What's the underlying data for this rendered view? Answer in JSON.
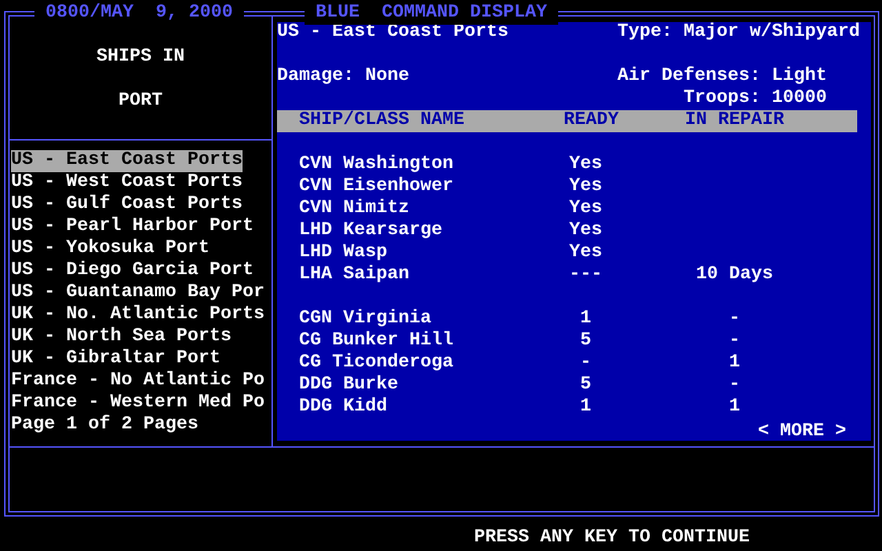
{
  "window": {
    "datetime": "0800/MAY  9, 2000",
    "title": "BLUE  COMMAND DISPLAY"
  },
  "sidebar": {
    "heading": [
      "SHIPS IN",
      "PORT"
    ],
    "items": [
      {
        "label": "US - East Coast Ports",
        "selected": true
      },
      {
        "label": "US - West Coast Ports",
        "selected": false
      },
      {
        "label": "US - Gulf Coast Ports",
        "selected": false
      },
      {
        "label": "US - Pearl Harbor Port",
        "selected": false
      },
      {
        "label": "US - Yokosuka Port",
        "selected": false
      },
      {
        "label": "US - Diego Garcia Port",
        "selected": false
      },
      {
        "label": "US - Guantanamo Bay Por",
        "selected": false
      },
      {
        "label": "UK - No. Atlantic Ports",
        "selected": false
      },
      {
        "label": "UK - North Sea Ports",
        "selected": false
      },
      {
        "label": "UK - Gibraltar Port",
        "selected": false
      },
      {
        "label": "France - No Atlantic Po",
        "selected": false
      },
      {
        "label": "France - Western Med Po",
        "selected": false
      }
    ],
    "page": "Page 1 of 2 Pages"
  },
  "port": {
    "name": "US - East Coast Ports",
    "type": "Type: Major w/Shipyard",
    "damage": "Damage: None",
    "air_defenses": "Air Defenses: Light",
    "troops": "Troops: 10000"
  },
  "table": {
    "columns": [
      "SHIP/CLASS NAME",
      "READY",
      "IN REPAIR"
    ],
    "groups": [
      {
        "rows": [
          [
            "CVN Washington",
            "Yes",
            ""
          ],
          [
            "CVN Eisenhower",
            "Yes",
            ""
          ],
          [
            "CVN Nimitz",
            "Yes",
            ""
          ],
          [
            "LHD Kearsarge",
            "Yes",
            ""
          ],
          [
            "LHD Wasp",
            "Yes",
            ""
          ],
          [
            "LHA Saipan",
            "---",
            "10 Days"
          ]
        ]
      },
      {
        "rows": [
          [
            "CGN Virginia",
            "1",
            "-"
          ],
          [
            "CG Bunker Hill",
            "5",
            "-"
          ],
          [
            "CG Ticonderoga",
            "-",
            "1"
          ],
          [
            "DDG Burke",
            "5",
            "-"
          ],
          [
            "DDG Kidd",
            "1",
            "1"
          ]
        ]
      }
    ],
    "more": "< MORE >"
  },
  "prompt": "PRESS ANY KEY TO CONTINUE"
}
